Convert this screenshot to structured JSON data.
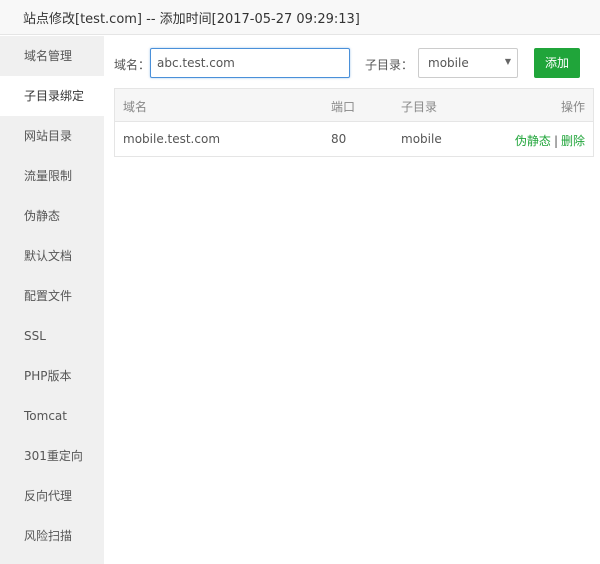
{
  "window": {
    "title": "站点修改[test.com] -- 添加时间[2017-05-27 09:29:13]"
  },
  "sidebar": {
    "items": [
      {
        "label": "域名管理"
      },
      {
        "label": "子目录绑定"
      },
      {
        "label": "网站目录"
      },
      {
        "label": "流量限制"
      },
      {
        "label": "伪静态"
      },
      {
        "label": "默认文档"
      },
      {
        "label": "配置文件"
      },
      {
        "label": "SSL"
      },
      {
        "label": "PHP版本"
      },
      {
        "label": "Tomcat"
      },
      {
        "label": "301重定向"
      },
      {
        "label": "反向代理"
      },
      {
        "label": "风险扫描"
      }
    ],
    "active": "子目录绑定"
  },
  "form": {
    "domain_label": "域名：",
    "domain_value": "abc.test.com",
    "subdir_label": "子目录：",
    "subdir_selected": "mobile",
    "add_button": "添加"
  },
  "table": {
    "headers": {
      "domain": "域名",
      "port": "端口",
      "subdir": "子目录",
      "ops": "操作"
    },
    "rows": [
      {
        "domain": "mobile.test.com",
        "port": "80",
        "subdir": "mobile",
        "op_rewrite": "伪静态",
        "op_sep": "|",
        "op_delete": "删除"
      }
    ]
  },
  "colors": {
    "accent": "#20a53a",
    "focus_border": "#4a90d9",
    "sidebar_bg": "#f0f0f0"
  }
}
